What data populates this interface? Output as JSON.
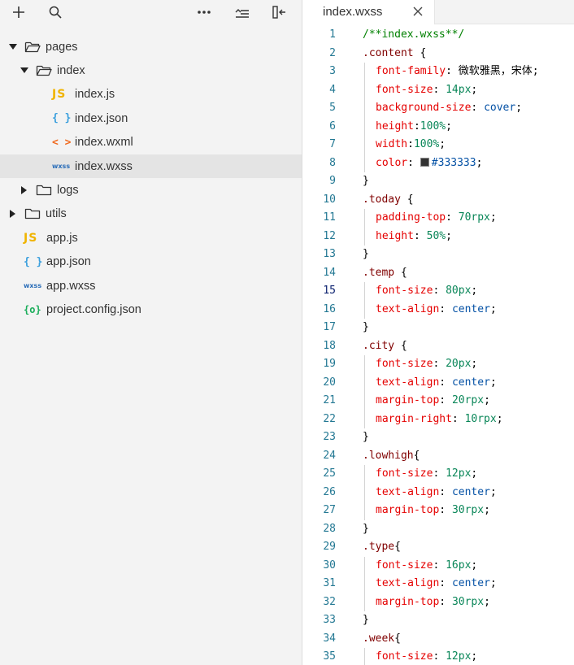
{
  "explorer": {
    "toolbar": {
      "add_icon": "plus-icon",
      "search_icon": "search-icon",
      "more_icon": "more-icon",
      "collapse_icon": "collapse-all-icon",
      "layout_icon": "toggle-panel-icon"
    },
    "tree": [
      {
        "label": "pages",
        "type": "folder",
        "expanded": true,
        "depth": 0
      },
      {
        "label": "index",
        "type": "folder",
        "expanded": true,
        "depth": 1
      },
      {
        "label": "index.js",
        "type": "js",
        "icon_text": "JS",
        "depth": 2
      },
      {
        "label": "index.json",
        "type": "json",
        "icon_text": "{ }",
        "depth": 2
      },
      {
        "label": "index.wxml",
        "type": "wxml",
        "icon_text": "< >",
        "depth": 2
      },
      {
        "label": "index.wxss",
        "type": "wxss",
        "icon_text": "wxss",
        "depth": 2,
        "selected": true
      },
      {
        "label": "logs",
        "type": "folder",
        "expanded": false,
        "depth": 1
      },
      {
        "label": "utils",
        "type": "folder",
        "expanded": false,
        "depth": 0
      },
      {
        "label": "app.js",
        "type": "js",
        "icon_text": "JS",
        "depth": 0
      },
      {
        "label": "app.json",
        "type": "json",
        "icon_text": "{ }",
        "depth": 0
      },
      {
        "label": "app.wxss",
        "type": "wxss",
        "icon_text": "wxss",
        "depth": 0
      },
      {
        "label": "project.config.json",
        "type": "config",
        "icon_text": "{o}",
        "depth": 0
      }
    ]
  },
  "editor": {
    "tab": {
      "label": "index.wxss",
      "close_icon": "close-icon"
    },
    "active_line": 15,
    "lines": [
      {
        "n": "1",
        "tokens": [
          {
            "t": "/**index.wxss**/",
            "c": "comment"
          }
        ]
      },
      {
        "n": "2",
        "tokens": [
          {
            "t": ".content",
            "c": "sel"
          },
          {
            "t": " {",
            "c": "punc"
          }
        ]
      },
      {
        "n": "3",
        "indent": true,
        "tokens": [
          {
            "t": "font-family",
            "c": "prop"
          },
          {
            "t": ": ",
            "c": "punc"
          },
          {
            "t": "微软雅黑，宋体",
            "c": "str"
          },
          {
            "t": ";",
            "c": "punc"
          }
        ]
      },
      {
        "n": "4",
        "indent": true,
        "tokens": [
          {
            "t": "font-size",
            "c": "prop"
          },
          {
            "t": ": ",
            "c": "punc"
          },
          {
            "t": "14px",
            "c": "num"
          },
          {
            "t": ";",
            "c": "punc"
          }
        ]
      },
      {
        "n": "5",
        "indent": true,
        "tokens": [
          {
            "t": "background-size",
            "c": "prop"
          },
          {
            "t": ": ",
            "c": "punc"
          },
          {
            "t": "cover",
            "c": "val"
          },
          {
            "t": ";",
            "c": "punc"
          }
        ]
      },
      {
        "n": "6",
        "indent": true,
        "tokens": [
          {
            "t": "height",
            "c": "prop"
          },
          {
            "t": ":",
            "c": "punc"
          },
          {
            "t": "100%",
            "c": "num"
          },
          {
            "t": ";",
            "c": "punc"
          }
        ]
      },
      {
        "n": "7",
        "indent": true,
        "tokens": [
          {
            "t": "width",
            "c": "prop"
          },
          {
            "t": ":",
            "c": "punc"
          },
          {
            "t": "100%",
            "c": "num"
          },
          {
            "t": ";",
            "c": "punc"
          }
        ]
      },
      {
        "n": "8",
        "indent": true,
        "tokens": [
          {
            "t": "color",
            "c": "prop"
          },
          {
            "t": ": ",
            "c": "punc"
          },
          {
            "t": "",
            "c": "swatch"
          },
          {
            "t": "#333333",
            "c": "val"
          },
          {
            "t": ";",
            "c": "punc"
          }
        ]
      },
      {
        "n": "9",
        "tokens": [
          {
            "t": "}",
            "c": "punc"
          }
        ]
      },
      {
        "n": "10",
        "tokens": [
          {
            "t": ".today",
            "c": "sel"
          },
          {
            "t": " {",
            "c": "punc"
          }
        ]
      },
      {
        "n": "11",
        "indent": true,
        "tokens": [
          {
            "t": "padding-top",
            "c": "prop"
          },
          {
            "t": ": ",
            "c": "punc"
          },
          {
            "t": "70rpx",
            "c": "num"
          },
          {
            "t": ";",
            "c": "punc"
          }
        ]
      },
      {
        "n": "12",
        "indent": true,
        "tokens": [
          {
            "t": "height",
            "c": "prop"
          },
          {
            "t": ": ",
            "c": "punc"
          },
          {
            "t": "50%",
            "c": "num"
          },
          {
            "t": ";",
            "c": "punc"
          }
        ]
      },
      {
        "n": "13",
        "tokens": [
          {
            "t": "}",
            "c": "punc"
          }
        ]
      },
      {
        "n": "14",
        "tokens": [
          {
            "t": ".temp",
            "c": "sel"
          },
          {
            "t": " {",
            "c": "punc"
          }
        ]
      },
      {
        "n": "15",
        "indent": true,
        "tokens": [
          {
            "t": "font-size",
            "c": "prop"
          },
          {
            "t": ": ",
            "c": "punc"
          },
          {
            "t": "80px",
            "c": "num"
          },
          {
            "t": ";",
            "c": "punc"
          }
        ]
      },
      {
        "n": "16",
        "indent": true,
        "tokens": [
          {
            "t": "text-align",
            "c": "prop"
          },
          {
            "t": ": ",
            "c": "punc"
          },
          {
            "t": "center",
            "c": "val"
          },
          {
            "t": ";",
            "c": "punc"
          }
        ]
      },
      {
        "n": "17",
        "tokens": [
          {
            "t": "}",
            "c": "punc"
          }
        ]
      },
      {
        "n": "18",
        "tokens": [
          {
            "t": ".city",
            "c": "sel"
          },
          {
            "t": " {",
            "c": "punc"
          }
        ]
      },
      {
        "n": "19",
        "indent": true,
        "tokens": [
          {
            "t": "font-size",
            "c": "prop"
          },
          {
            "t": ": ",
            "c": "punc"
          },
          {
            "t": "20px",
            "c": "num"
          },
          {
            "t": ";",
            "c": "punc"
          }
        ]
      },
      {
        "n": "20",
        "indent": true,
        "tokens": [
          {
            "t": "text-align",
            "c": "prop"
          },
          {
            "t": ": ",
            "c": "punc"
          },
          {
            "t": "center",
            "c": "val"
          },
          {
            "t": ";",
            "c": "punc"
          }
        ]
      },
      {
        "n": "21",
        "indent": true,
        "tokens": [
          {
            "t": "margin-top",
            "c": "prop"
          },
          {
            "t": ": ",
            "c": "punc"
          },
          {
            "t": "20rpx",
            "c": "num"
          },
          {
            "t": ";",
            "c": "punc"
          }
        ]
      },
      {
        "n": "22",
        "indent": true,
        "tokens": [
          {
            "t": "margin-right",
            "c": "prop"
          },
          {
            "t": ": ",
            "c": "punc"
          },
          {
            "t": "10rpx",
            "c": "num"
          },
          {
            "t": ";",
            "c": "punc"
          }
        ]
      },
      {
        "n": "23",
        "tokens": [
          {
            "t": "}",
            "c": "punc"
          }
        ]
      },
      {
        "n": "24",
        "tokens": [
          {
            "t": ".lowhigh",
            "c": "sel"
          },
          {
            "t": "{",
            "c": "punc"
          }
        ]
      },
      {
        "n": "25",
        "indent": true,
        "tokens": [
          {
            "t": "font-size",
            "c": "prop"
          },
          {
            "t": ": ",
            "c": "punc"
          },
          {
            "t": "12px",
            "c": "num"
          },
          {
            "t": ";",
            "c": "punc"
          }
        ]
      },
      {
        "n": "26",
        "indent": true,
        "tokens": [
          {
            "t": "text-align",
            "c": "prop"
          },
          {
            "t": ": ",
            "c": "punc"
          },
          {
            "t": "center",
            "c": "val"
          },
          {
            "t": ";",
            "c": "punc"
          }
        ]
      },
      {
        "n": "27",
        "indent": true,
        "tokens": [
          {
            "t": "margin-top",
            "c": "prop"
          },
          {
            "t": ": ",
            "c": "punc"
          },
          {
            "t": "30rpx",
            "c": "num"
          },
          {
            "t": ";",
            "c": "punc"
          }
        ]
      },
      {
        "n": "28",
        "tokens": [
          {
            "t": "}",
            "c": "punc"
          }
        ]
      },
      {
        "n": "29",
        "tokens": [
          {
            "t": ".type",
            "c": "sel"
          },
          {
            "t": "{",
            "c": "punc"
          }
        ]
      },
      {
        "n": "30",
        "indent": true,
        "tokens": [
          {
            "t": "font-size",
            "c": "prop"
          },
          {
            "t": ": ",
            "c": "punc"
          },
          {
            "t": "16px",
            "c": "num"
          },
          {
            "t": ";",
            "c": "punc"
          }
        ]
      },
      {
        "n": "31",
        "indent": true,
        "tokens": [
          {
            "t": "text-align",
            "c": "prop"
          },
          {
            "t": ": ",
            "c": "punc"
          },
          {
            "t": "center",
            "c": "val"
          },
          {
            "t": ";",
            "c": "punc"
          }
        ]
      },
      {
        "n": "32",
        "indent": true,
        "tokens": [
          {
            "t": "margin-top",
            "c": "prop"
          },
          {
            "t": ": ",
            "c": "punc"
          },
          {
            "t": "30rpx",
            "c": "num"
          },
          {
            "t": ";",
            "c": "punc"
          }
        ]
      },
      {
        "n": "33",
        "tokens": [
          {
            "t": "}",
            "c": "punc"
          }
        ]
      },
      {
        "n": "34",
        "tokens": [
          {
            "t": ".week",
            "c": "sel"
          },
          {
            "t": "{",
            "c": "punc"
          }
        ]
      },
      {
        "n": "35",
        "indent": true,
        "tokens": [
          {
            "t": "font-size",
            "c": "prop"
          },
          {
            "t": ": ",
            "c": "punc"
          },
          {
            "t": "12px",
            "c": "num"
          },
          {
            "t": ";",
            "c": "punc"
          }
        ]
      }
    ]
  }
}
